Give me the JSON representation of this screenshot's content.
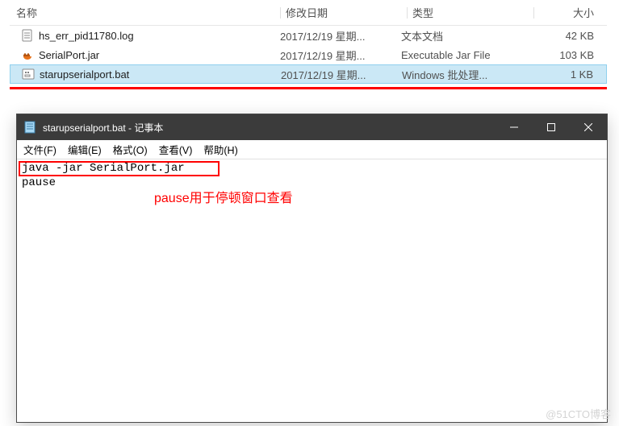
{
  "explorer": {
    "headers": {
      "name": "名称",
      "date": "修改日期",
      "type": "类型",
      "size": "大小"
    },
    "rows": [
      {
        "name": "hs_err_pid11780.log",
        "date": "2017/12/19 星期...",
        "type": "文本文档",
        "size": "42 KB"
      },
      {
        "name": "SerialPort.jar",
        "date": "2017/12/19 星期...",
        "type": "Executable Jar File",
        "size": "103 KB"
      },
      {
        "name": "starupserialport.bat",
        "date": "2017/12/19 星期...",
        "type": "Windows 批处理...",
        "size": "1 KB"
      }
    ]
  },
  "notepad": {
    "title": "starupserialport.bat - 记事本",
    "menu": {
      "file": "文件(F)",
      "edit": "编辑(E)",
      "format": "格式(O)",
      "view": "查看(V)",
      "help": "帮助(H)"
    },
    "line1": "java -jar SerialPort.jar",
    "line2": "pause",
    "annotation": "pause用于停顿窗口查看"
  },
  "watermark": "@51CTO博客"
}
